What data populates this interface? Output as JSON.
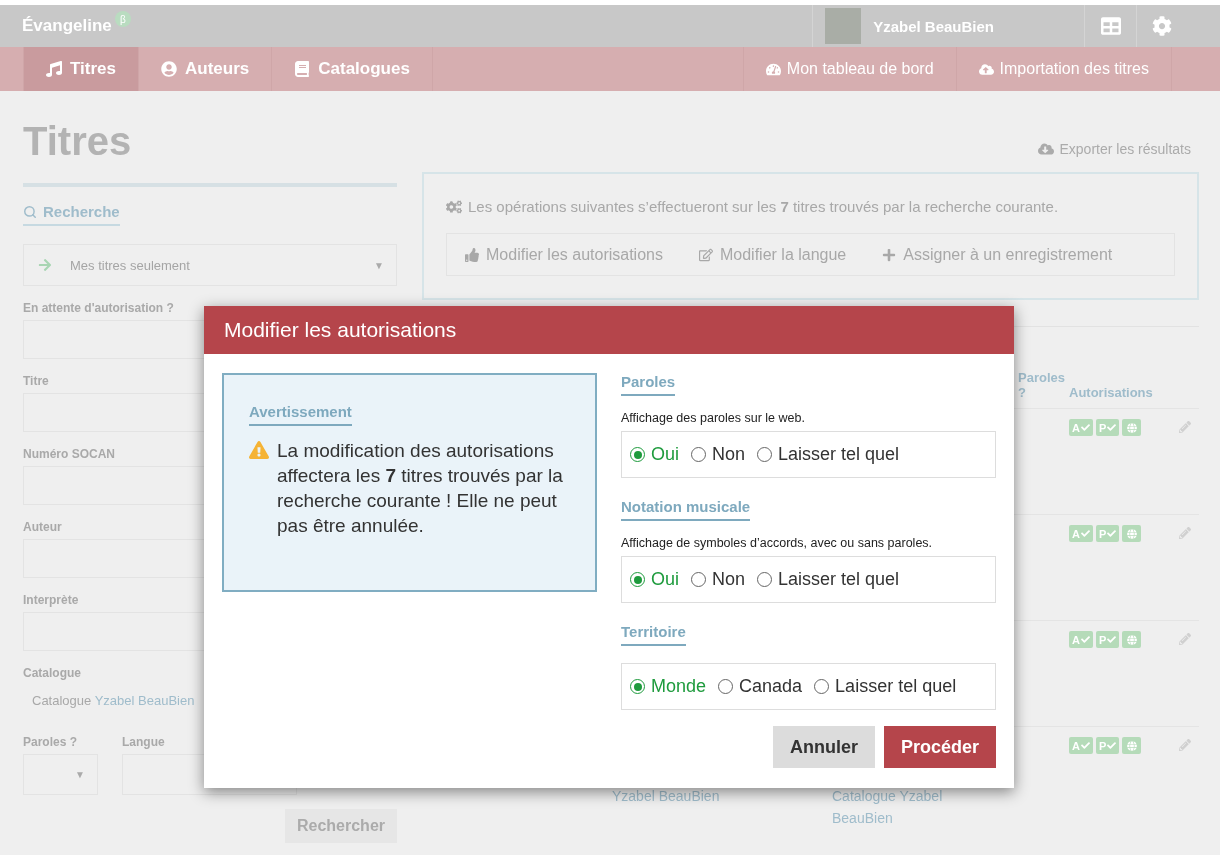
{
  "app": {
    "name": "Évangeline",
    "badge": "β"
  },
  "user": {
    "name": "Yzabel BeauBien"
  },
  "nav": {
    "left": [
      {
        "label": "Titres",
        "selected": true
      },
      {
        "label": "Auteurs",
        "selected": false
      },
      {
        "label": "Catalogues",
        "selected": false
      }
    ],
    "right": [
      {
        "label": "Mon tableau de bord"
      },
      {
        "label": "Importation des titres"
      }
    ]
  },
  "page": {
    "title": "Titres",
    "export": "Exporter les résultats"
  },
  "search": {
    "tab": "Recherche",
    "scope": "Mes titres seulement",
    "caret": "▼",
    "fields": [
      {
        "label": "En attente d'autorisation ?"
      },
      {
        "label": "Titre"
      },
      {
        "label": "Numéro SOCAN"
      },
      {
        "label": "Auteur"
      },
      {
        "label": "Interprète"
      }
    ],
    "catalogue_label": "Catalogue",
    "catalogue_tag": {
      "prefix": "Catalogue",
      "name": "Yzabel BeauBien"
    },
    "lyrics_label": "Paroles ?",
    "lyrics_caret": "▼",
    "language_label": "Langue",
    "button": "Rechercher"
  },
  "operations": {
    "text": "Les opérations suivantes s’effectueront sur les **7** titres trouvés par la recherche courante.",
    "actions": [
      {
        "label": "Modifier les autorisations"
      },
      {
        "label": "Modifier la langue"
      },
      {
        "label": "Assigner à un enregistrement"
      }
    ]
  },
  "table": {
    "columns_visible": [
      "Paroles ?",
      "Autorisations"
    ],
    "rows": [
      {
        "badges": [
          "A",
          "P"
        ],
        "below": []
      },
      {
        "badges": [
          "A",
          "P"
        ],
        "below": []
      },
      {
        "badges": [
          "A",
          "P"
        ],
        "below": []
      },
      {
        "badges": [
          "A",
          "P"
        ],
        "below": [
          "Yzabel BeauBien",
          "Catalogue Yzabel BeauBien"
        ]
      }
    ]
  },
  "modal": {
    "title": "Modifier les autorisations",
    "warning": {
      "title": "Avertissement",
      "text": "La modification des autorisations affectera les **7** titres trouvés par la recherche courante ! Elle ne peut pas être annulée."
    },
    "groups": [
      {
        "title": "Paroles",
        "description": "Affichage des paroles sur le web.",
        "options": [
          {
            "label": "Oui",
            "selected": true
          },
          {
            "label": "Non",
            "selected": false
          },
          {
            "label": "Laisser tel quel",
            "selected": false
          }
        ]
      },
      {
        "title": "Notation musicale",
        "description": "Affichage de symboles d’accords, avec ou sans paroles.",
        "options": [
          {
            "label": "Oui",
            "selected": true
          },
          {
            "label": "Non",
            "selected": false
          },
          {
            "label": "Laisser tel quel",
            "selected": false
          }
        ]
      },
      {
        "title": "Territoire",
        "options": [
          {
            "label": "Monde",
            "selected": true
          },
          {
            "label": "Canada",
            "selected": false
          },
          {
            "label": "Laisser tel quel",
            "selected": false
          }
        ]
      }
    ],
    "buttons": [
      {
        "label": "Annuler",
        "kind": "secondary"
      },
      {
        "label": "Procéder",
        "kind": "primary"
      }
    ]
  }
}
